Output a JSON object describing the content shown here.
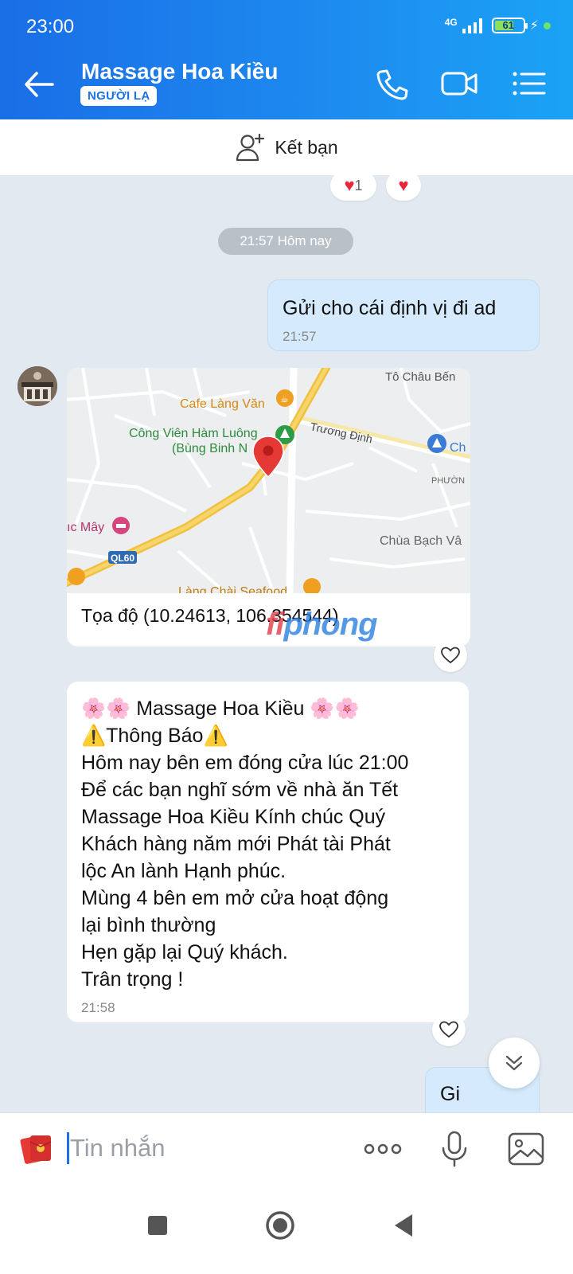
{
  "status_bar": {
    "time": "23:00",
    "network": "4G",
    "battery": "61"
  },
  "header": {
    "title": "Massage Hoa Kiều",
    "badge": "NGƯỜI LẠ"
  },
  "add_friend": {
    "label": "Kết bạn"
  },
  "chat": {
    "reaction_count": "1",
    "date_separator": "21:57 Hôm nay",
    "messages": [
      {
        "direction": "outgoing",
        "text": "Gửi cho cái định vị đi ad",
        "time": "21:57"
      },
      {
        "direction": "incoming",
        "type": "location",
        "map_labels": {
          "poi1": "Tô Châu Bến",
          "poi2": "Cafe Làng Văn",
          "poi3": "Công Viên Hàm Luông",
          "poi3b": "(Bùng Binh N",
          "road": "Trương Định",
          "poi4": "Ch",
          "poi5": "PHƯỜN",
          "poi6": "ıc Mây",
          "poi7": "Chùa Bạch Vâ",
          "highway": "QL60",
          "poi8": "Làng Chài Seafood"
        },
        "coordinates": "Tọa độ (10.24613, 106.354544)"
      },
      {
        "direction": "incoming",
        "type": "text",
        "lines": [
          "🌸🌸 Massage Hoa Kiều 🌸🌸",
          "⚠️Thông Báo⚠️",
          "Hôm nay bên em đóng cửa lúc 21:00",
          "Để các bạn nghĩ sớm về nhà ăn Tết",
          "Massage Hoa Kiều Kính chúc Quý",
          "Khách hàng năm mới Phát tài Phát",
          "lộc An lành Hạnh phúc.",
          "Mùng 4 bên em mở cửa hoạt động",
          "lại bình thường",
          "Hẹn gặp lại Quý khách.",
          "Trân trọng !"
        ],
        "time": "21:58"
      },
      {
        "direction": "outgoing",
        "text": "Gi"
      }
    ]
  },
  "watermark": {
    "part1": "fi",
    "part2": "phong"
  },
  "input_bar": {
    "placeholder": "Tin nhắn"
  },
  "colors": {
    "header_gradient_start": "#1a6ee6",
    "header_gradient_end": "#1aa3f5",
    "chat_background": "#e2e9f1",
    "outgoing_bubble": "#d5ebfd",
    "incoming_bubble": "#ffffff",
    "accent": "#1a72e8",
    "map_pin": "#e53935",
    "heart": "#e8283a"
  },
  "icons": [
    "back-arrow-icon",
    "phone-icon",
    "video-call-icon",
    "menu-list-icon",
    "add-person-icon",
    "heart-icon",
    "heart-outline-icon",
    "chevron-double-down-icon",
    "red-envelope-sticker-icon",
    "more-dots-icon",
    "microphone-icon",
    "image-icon",
    "nav-square-icon",
    "nav-circle-icon",
    "nav-back-triangle-icon"
  ]
}
